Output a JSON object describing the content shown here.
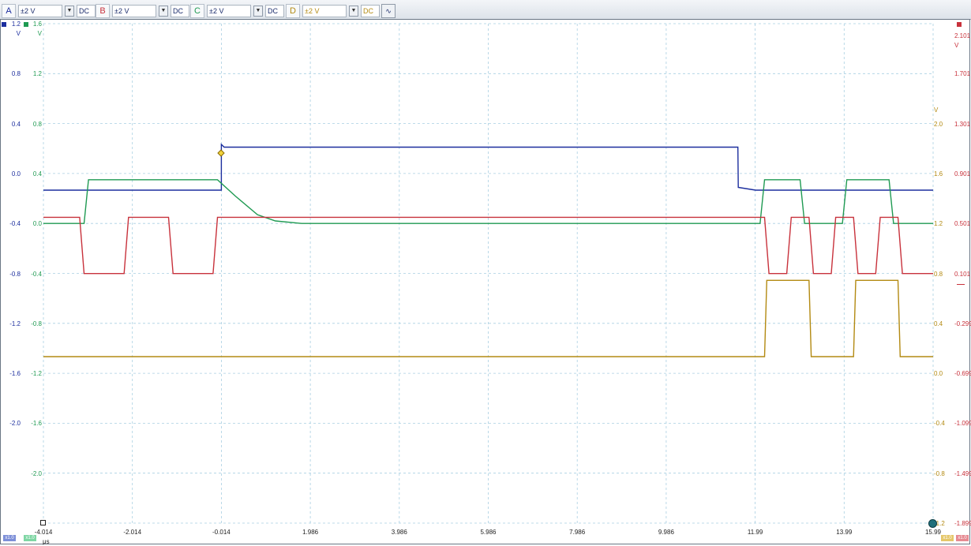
{
  "toolbar": {
    "channels": [
      {
        "letter": "A",
        "range": "±2 V",
        "coupling": "DC",
        "color": "#1c2e9e"
      },
      {
        "letter": "B",
        "range": "±2 V",
        "coupling": "DC",
        "color": "#c8323c"
      },
      {
        "letter": "C",
        "range": "±2 V",
        "coupling": "DC",
        "color": "#1f9a52"
      },
      {
        "letter": "D",
        "range": "±2 V",
        "coupling": "DC",
        "color": "#b38a12"
      }
    ],
    "dropdown_icon": "chevron-down-icon",
    "math_button_icon": "math-channels-icon"
  },
  "axes": {
    "a": {
      "unit": "V",
      "ticks": [
        "1.2",
        "0.8",
        "0.4",
        "0.0",
        "-0.4",
        "-0.8",
        "-1.2",
        "-1.6",
        "-2.0"
      ]
    },
    "c": {
      "top": "1.6",
      "unit": "V",
      "ticks": [
        "1.2",
        "0.8",
        "0.4",
        "0.0",
        "-0.4",
        "-0.8",
        "-1.2",
        "-1.6",
        "-2.0"
      ]
    },
    "b": {
      "top": "2.101",
      "unit": "V",
      "ticks": [
        "1.701",
        "1.301",
        "0.901",
        "0.501",
        "0.101",
        "-0.299",
        "-0.699",
        "-1.099",
        "-1.499",
        "-1.899"
      ]
    },
    "d": {
      "unit": "V",
      "ticks": [
        "2.0",
        "1.6",
        "1.2",
        "0.8",
        "0.4",
        "0.0",
        "-0.4",
        "-0.8",
        "-1.2"
      ]
    },
    "x": {
      "unit": "μs",
      "ticks": [
        "-4.014",
        "-2.014",
        "-0.014",
        "1.986",
        "3.986",
        "5.986",
        "7.986",
        "9.986",
        "11.99",
        "13.99",
        "15.99"
      ]
    }
  },
  "scale_badges": [
    "x1.0",
    "x1.0",
    "x1.0",
    "x1.0"
  ],
  "chart_data": {
    "type": "line",
    "title": "",
    "xlabel": "μs",
    "ylabel": "V",
    "xlim": [
      -4.014,
      15.99
    ],
    "grid": true,
    "series": [
      {
        "name": "A",
        "color": "#1c2e9e",
        "axis": "a",
        "ylim": [
          -2.4,
          1.2
        ],
        "x": [
          -4.014,
          -0.014,
          -0.013,
          0.05,
          11.6,
          11.61,
          12.0,
          15.99
        ],
        "y": [
          0.0,
          0.0,
          0.33,
          0.31,
          0.31,
          0.02,
          0.0,
          0.0
        ]
      },
      {
        "name": "C",
        "color": "#1f9a52",
        "axis": "c",
        "ylim": [
          -2.4,
          1.6
        ],
        "x": [
          -4.014,
          -3.1,
          -3.0,
          -0.1,
          0.3,
          0.8,
          1.2,
          1.8,
          12.1,
          12.2,
          13.0,
          13.1,
          13.95,
          14.05,
          15.0,
          15.1,
          15.99
        ],
        "y": [
          0.0,
          0.0,
          0.35,
          0.35,
          0.22,
          0.07,
          0.02,
          0.0,
          0.0,
          0.35,
          0.35,
          0.0,
          0.0,
          0.35,
          0.35,
          0.0,
          0.0
        ]
      },
      {
        "name": "B",
        "color": "#c8323c",
        "axis": "b",
        "ylim": [
          -1.899,
          2.101
        ],
        "x": [
          -4.014,
          -3.2,
          -3.1,
          -2.2,
          -2.1,
          -1.2,
          -1.1,
          -0.2,
          -0.1,
          12.2,
          12.3,
          12.7,
          12.8,
          13.2,
          13.3,
          13.7,
          13.8,
          14.2,
          14.3,
          14.7,
          14.8,
          15.2,
          15.3,
          15.99
        ],
        "y": [
          0.55,
          0.55,
          0.1,
          0.1,
          0.55,
          0.55,
          0.1,
          0.1,
          0.55,
          0.55,
          0.1,
          0.1,
          0.55,
          0.55,
          0.1,
          0.1,
          0.55,
          0.55,
          0.1,
          0.1,
          0.55,
          0.55,
          0.1,
          0.1
        ]
      },
      {
        "name": "D",
        "color": "#b38a12",
        "axis": "d",
        "ylim": [
          -1.2,
          2.4
        ],
        "x": [
          -4.014,
          12.2,
          12.25,
          13.2,
          13.25,
          14.2,
          14.25,
          15.2,
          15.25,
          15.99
        ],
        "y": [
          0.0,
          0.0,
          0.55,
          0.55,
          0.0,
          0.0,
          0.55,
          0.55,
          0.0,
          0.0
        ]
      }
    ]
  }
}
